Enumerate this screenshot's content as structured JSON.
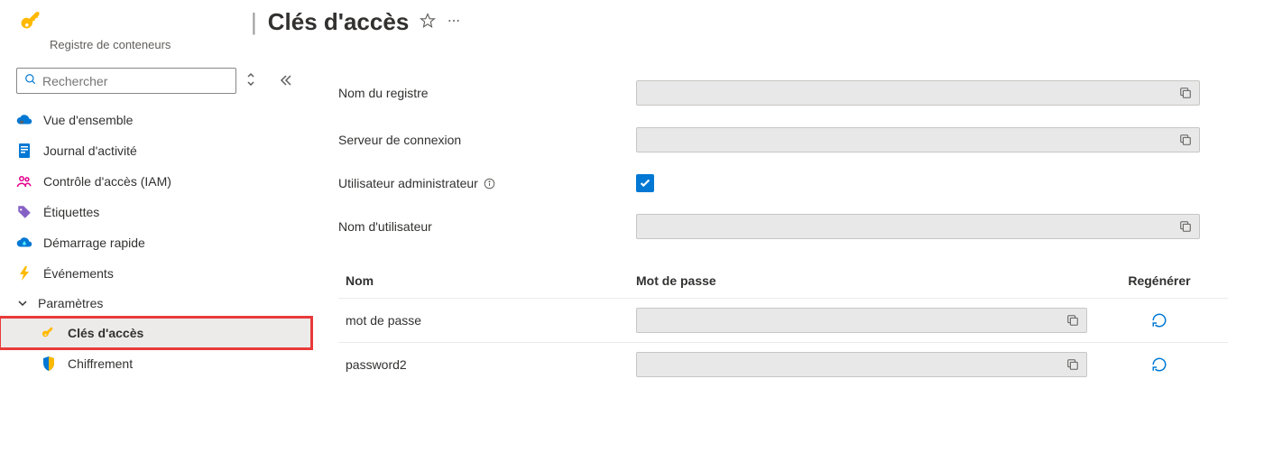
{
  "header": {
    "title": "Clés d'accès",
    "subtitle": "Registre de conteneurs"
  },
  "search": {
    "placeholder": "Rechercher"
  },
  "sidebar": {
    "items": [
      {
        "label": "Vue d'ensemble"
      },
      {
        "label": "Journal d'activité"
      },
      {
        "label": "Contrôle d'accès (IAM)"
      },
      {
        "label": "Étiquettes"
      },
      {
        "label": "Démarrage rapide"
      },
      {
        "label": "Événements"
      }
    ],
    "section": "Paramètres",
    "subitems": [
      {
        "label": "Clés d'accès"
      },
      {
        "label": "Chiffrement"
      }
    ]
  },
  "form": {
    "registry_name": {
      "label": "Nom du registre",
      "value": ""
    },
    "login_server": {
      "label": "Serveur de connexion",
      "value": ""
    },
    "admin_user": {
      "label": "Utilisateur administrateur",
      "checked": true
    },
    "username": {
      "label": "Nom d'utilisateur",
      "value": ""
    }
  },
  "table": {
    "headers": {
      "name": "Nom",
      "password": "Mot de passe",
      "regen": "Regénérer"
    },
    "rows": [
      {
        "name": "mot de passe",
        "value": ""
      },
      {
        "name": "password2",
        "value": ""
      }
    ]
  }
}
